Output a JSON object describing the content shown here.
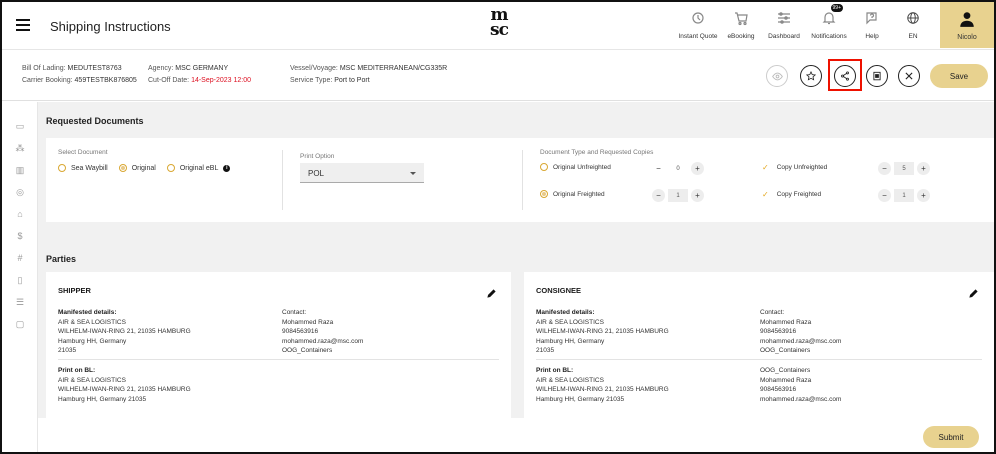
{
  "header": {
    "title": "Shipping Instructions",
    "logo_text": "msc",
    "nav": [
      {
        "label": "Instant Quote",
        "icon": "quote-icon"
      },
      {
        "label": "eBooking",
        "icon": "cart-icon"
      },
      {
        "label": "Dashboard",
        "icon": "dashboard-icon"
      },
      {
        "label": "Notifications",
        "icon": "bell-icon",
        "badge": "99+"
      },
      {
        "label": "Help",
        "icon": "help-icon"
      },
      {
        "label": "EN",
        "icon": "globe-icon"
      }
    ],
    "user": {
      "label": "Nicolo"
    }
  },
  "info": {
    "bill_of_lading_label": "Bill Of Lading:",
    "bill_of_lading": "MEDUTEST8763",
    "carrier_booking_label": "Carrier Booking:",
    "carrier_booking": "459TESTBK876805",
    "agency_label": "Agency:",
    "agency": "MSC GERMANY",
    "cutoff_label": "Cut-Off Date:",
    "cutoff": "14-Sep-2023 12:00",
    "vessel_label": "Vessel/Voyage:",
    "vessel": "MSC MEDITERRANEAN/CG335R",
    "service_label": "Service Type:",
    "service": "Port to Port",
    "save_label": "Save"
  },
  "requested": {
    "title": "Requested Documents",
    "select_label": "Select Document",
    "options": [
      "Sea Waybill",
      "Original",
      "Original eBL"
    ],
    "selected": "Original",
    "print_label": "Print Option",
    "print_value": "POL",
    "doc_type_label": "Document Type and Requested Copies",
    "rows": [
      {
        "name": "Original Unfreighted",
        "value": "0"
      },
      {
        "name": "Original Freighted",
        "value": "1"
      },
      {
        "name": "Copy Unfreighted",
        "value": "5"
      },
      {
        "name": "Copy Freighted",
        "value": "1"
      }
    ]
  },
  "parties": {
    "title": "Parties",
    "shipper": {
      "title": "SHIPPER",
      "manifested_label": "Manifested details:",
      "manifested": [
        "AIR & SEA LOGISTICS",
        "WILHELM-IWAN-RING 21, 21035 HAMBURG",
        "Hamburg HH, Germany",
        "21035"
      ],
      "contact_label": "Contact:",
      "contact": [
        "Mohammed Raza",
        "9084563916",
        "mohammed.raza@msc.com",
        "OOG_Containers"
      ],
      "print_label": "Print on BL:",
      "print": [
        "AIR & SEA LOGISTICS",
        "WILHELM-IWAN-RING 21, 21035 HAMBURG",
        "Hamburg HH, Germany 21035"
      ]
    },
    "consignee": {
      "title": "CONSIGNEE",
      "manifested_label": "Manifested details:",
      "manifested": [
        "AIR & SEA LOGISTICS",
        "WILHELM-IWAN-RING 21, 21035 HAMBURG",
        "Hamburg HH, Germany",
        "21035"
      ],
      "contact_label": "Contact:",
      "contact": [
        "Mohammed Raza",
        "9084563916",
        "mohammed.raza@msc.com",
        "OOG_Containers"
      ],
      "print_label": "Print on BL:",
      "print": [
        "AIR & SEA LOGISTICS",
        "WILHELM-IWAN-RING 21, 21035 HAMBURG",
        "Hamburg HH, Germany 21035"
      ],
      "print_contact": [
        "OOG_Containers",
        "Mohammed Raza",
        "9084563916",
        "mohammed.raza@msc.com"
      ]
    }
  },
  "footer": {
    "submit_label": "Submit"
  },
  "colors": {
    "accent": "#e8d28f",
    "highlight": "#e10000",
    "radio": "#d9a833"
  }
}
